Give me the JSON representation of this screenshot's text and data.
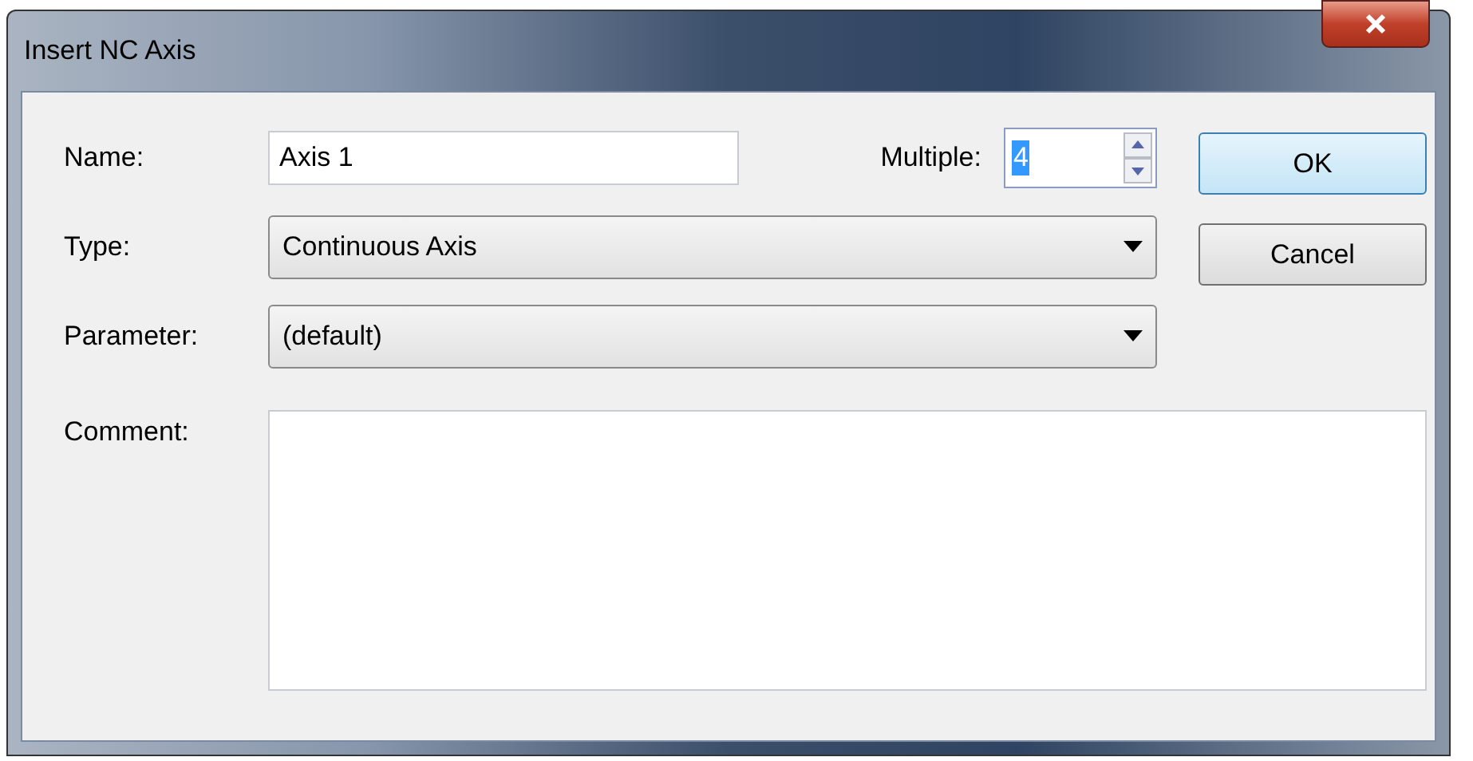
{
  "window": {
    "title": "Insert NC Axis"
  },
  "name": {
    "label": "Name:",
    "value": "Axis 1"
  },
  "multiple": {
    "label": "Multiple:",
    "value": "4",
    "text_selected": true
  },
  "type": {
    "label": "Type:",
    "value": "Continuous Axis"
  },
  "parameter": {
    "label": "Parameter:",
    "value": "(default)"
  },
  "comment": {
    "label": "Comment:"
  },
  "buttons": [
    {
      "label": "OK",
      "default": true
    },
    {
      "label": "Cancel",
      "default": false
    }
  ]
}
